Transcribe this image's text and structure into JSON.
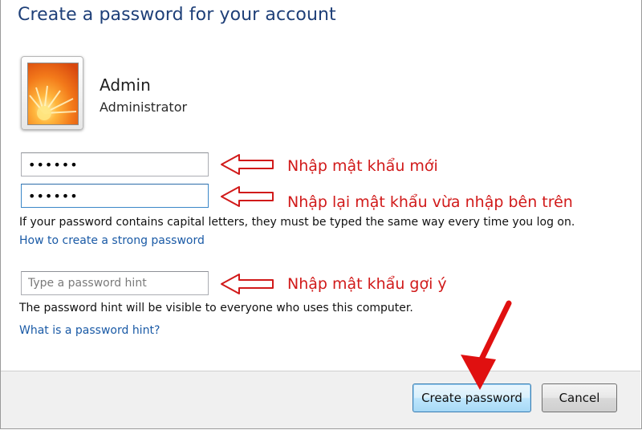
{
  "dialog": {
    "title": "Create a password for your account"
  },
  "user": {
    "name": "Admin",
    "role": "Administrator"
  },
  "fields": {
    "new_password_value": "••••••",
    "confirm_password_value": "••••••",
    "hint_placeholder": "Type a password hint",
    "hint_value": ""
  },
  "annotations": {
    "new_password": "Nhập mật khẩu mới",
    "confirm_password": "Nhập lại mật khẩu vừa nhập bên trên",
    "hint": "Nhập mật khẩu gợi ý"
  },
  "info": {
    "capital_letters": "If your password contains capital letters, they must be typed the same way every time you log on.",
    "hint_visibility": "The password hint will be visible to everyone who uses this computer."
  },
  "links": {
    "strong_password": "How to create a strong password",
    "what_is_hint": "What is a password hint?"
  },
  "buttons": {
    "create": "Create password",
    "cancel": "Cancel"
  },
  "colors": {
    "title": "#1e3f78",
    "annotation_red": "#d11a1a",
    "link": "#1a5aa6",
    "footer_bg": "#f0f0f0"
  },
  "icons": {
    "avatar": "flower-avatar-icon",
    "annotation_arrow": "hollow-left-arrow-icon",
    "pointer": "red-arrow-icon"
  }
}
